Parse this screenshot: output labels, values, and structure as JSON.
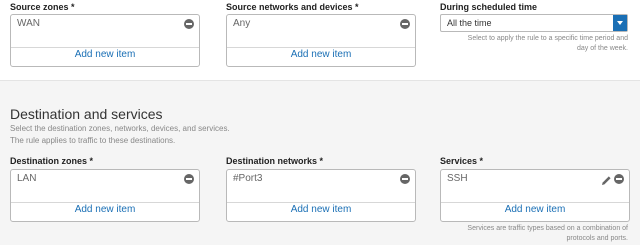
{
  "source": {
    "zones": {
      "label": "Source zones *",
      "items": [
        "WAN"
      ],
      "add_label": "Add new item"
    },
    "networks": {
      "label": "Source networks and devices *",
      "items": [
        "Any"
      ],
      "add_label": "Add new item"
    },
    "schedule": {
      "label": "During scheduled time",
      "selected": "All the time",
      "help_line1": "Select to apply the rule to a specific time period and",
      "help_line2": "day of the week."
    }
  },
  "destination": {
    "title": "Destination and services",
    "desc_line1": "Select the destination zones, networks, devices, and services.",
    "desc_line2": "The rule applies to traffic to these destinations.",
    "zones": {
      "label": "Destination zones *",
      "items": [
        "LAN"
      ],
      "add_label": "Add new item"
    },
    "networks": {
      "label": "Destination networks *",
      "items": [
        "#Port3"
      ],
      "add_label": "Add new item"
    },
    "services": {
      "label": "Services *",
      "items": [
        "SSH"
      ],
      "add_label": "Add new item",
      "help_line1": "Services are traffic types based on a combination of",
      "help_line2": "protocols and ports."
    }
  },
  "colors": {
    "link": "#1a6fb5",
    "select_button": "#1a6fb5"
  },
  "icons": [
    "remove-icon",
    "edit-icon",
    "chevron-down-icon"
  ]
}
